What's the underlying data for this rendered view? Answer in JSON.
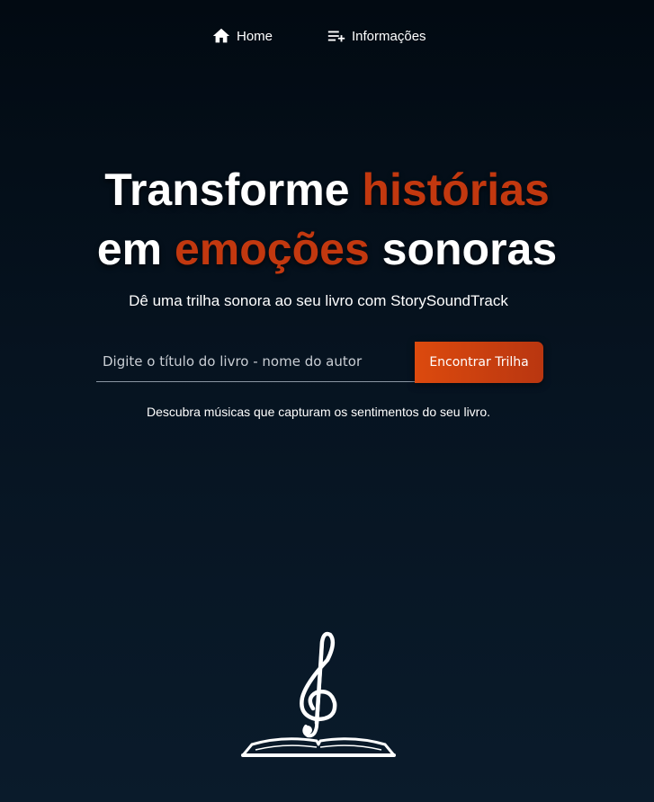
{
  "nav": {
    "items": [
      {
        "label": "Home",
        "icon": "home-icon"
      },
      {
        "label": "Informações",
        "icon": "playlist-add-icon"
      }
    ]
  },
  "hero": {
    "title_part1": "Transforme ",
    "title_accent1": "histórias",
    "title_part2": "em ",
    "title_accent2": "emoções",
    "title_part3": " sonoras",
    "subtitle": "Dê uma trilha sonora ao seu livro com StorySoundTrack"
  },
  "search": {
    "placeholder": "Digite o título do livro - nome do autor",
    "value": "",
    "button_label": "Encontrar Trilha"
  },
  "tagline": "Descubra músicas que capturam os sentimentos do seu livro.",
  "logo": {
    "icon": "treble-clef-book-icon"
  },
  "colors": {
    "accent": "#c2380f",
    "button": "#dc4a0e",
    "background": "#061320",
    "text": "#ffffff"
  }
}
